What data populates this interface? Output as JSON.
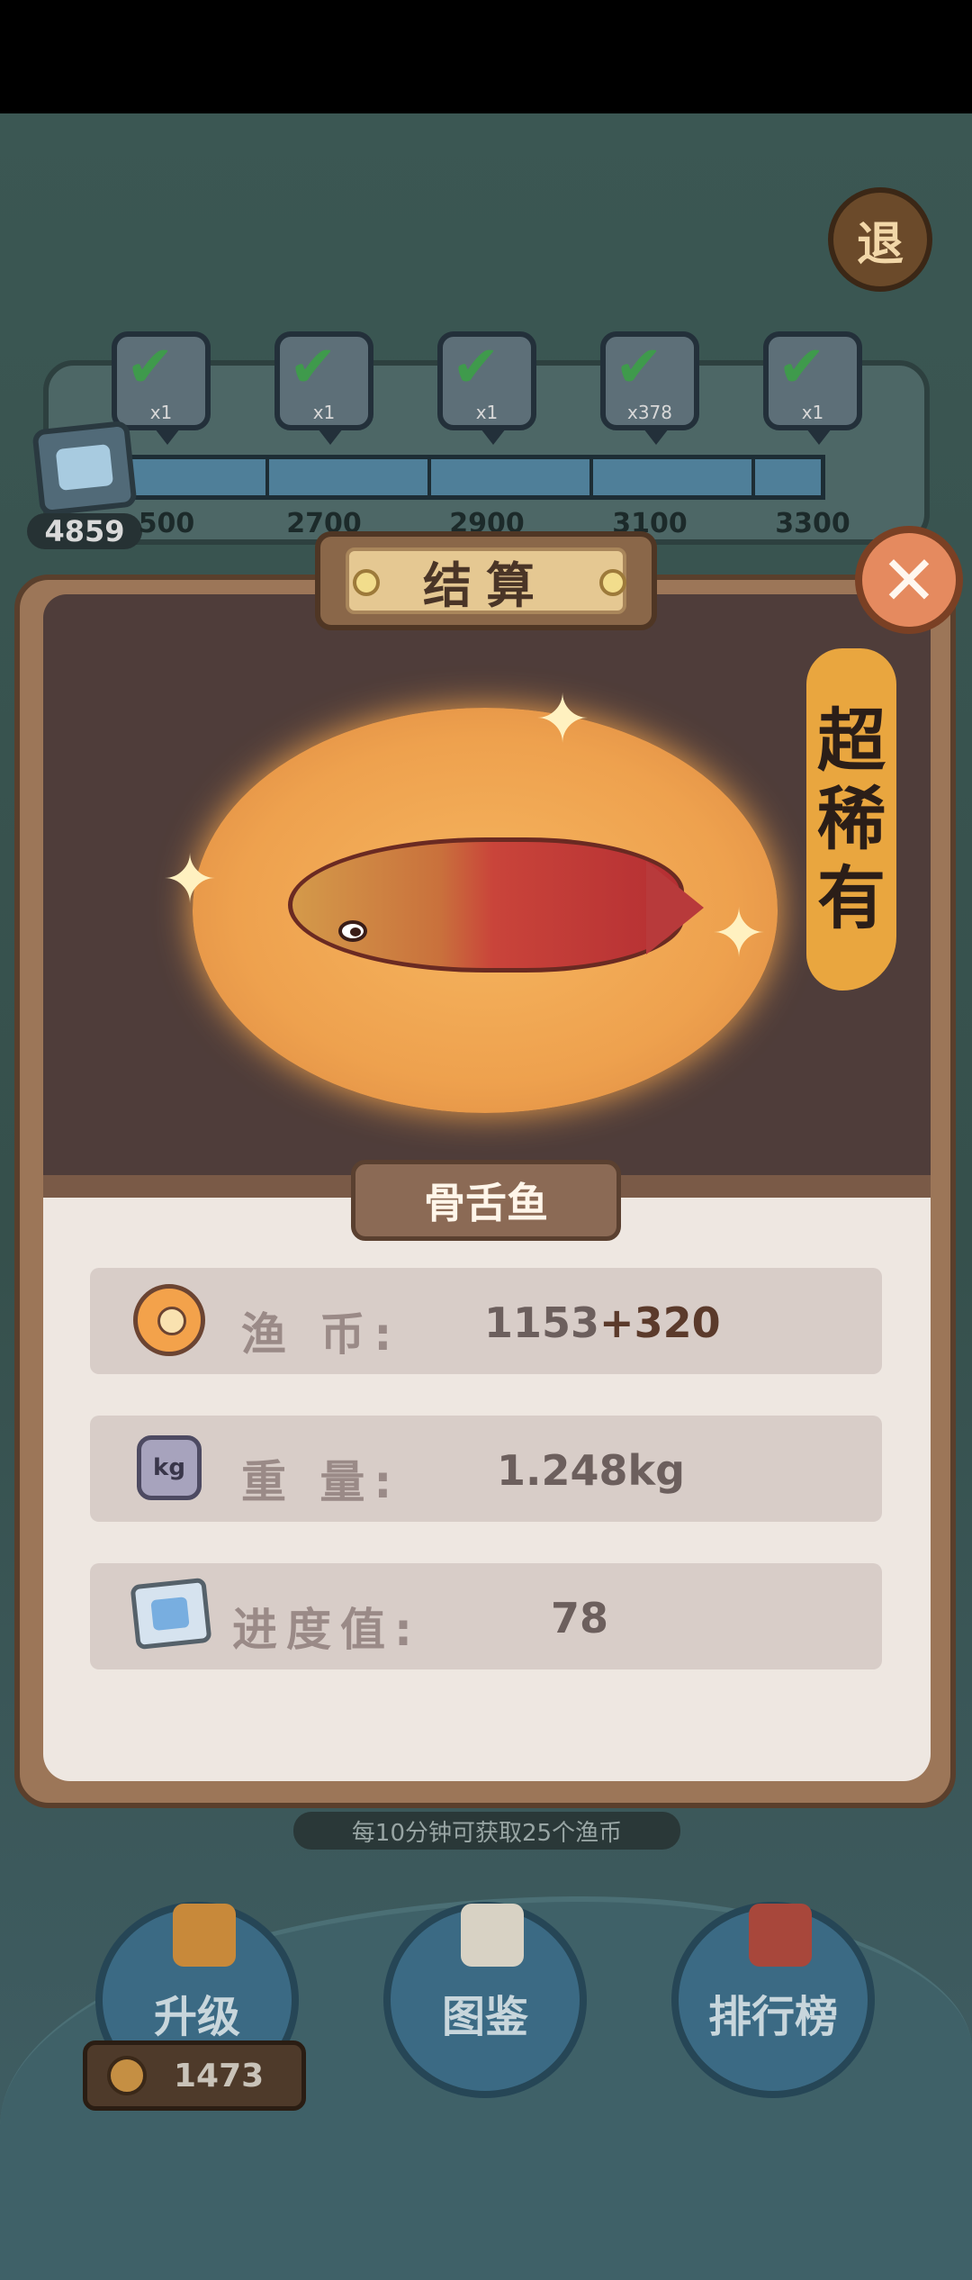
{
  "topbar": {
    "exit_label": "退"
  },
  "progress": {
    "total": "4859",
    "milestones": [
      "2500",
      "2700",
      "2900",
      "3100",
      "3300"
    ],
    "milestones_visible": [
      "500",
      "2700",
      "2900",
      "3100",
      "3300"
    ],
    "fill_fraction": 1.0
  },
  "rewards": [
    {
      "count": "x1"
    },
    {
      "count": "x1"
    },
    {
      "count": "x1"
    },
    {
      "count": "x378"
    },
    {
      "count": "x1"
    }
  ],
  "dialog": {
    "title": "结算",
    "rarity": [
      "超",
      "稀",
      "有"
    ],
    "fish_name": "骨舌鱼",
    "stats": [
      {
        "label": "渔 币:",
        "value": "1153",
        "extra": "+320",
        "icon": "coin-icon"
      },
      {
        "label": "重 量:",
        "value": "1.248kg",
        "icon": "weight-icon"
      },
      {
        "label": "进度值:",
        "value": "78",
        "icon": "ticket-icon"
      }
    ],
    "close_icon": "✕"
  },
  "tip": "每10分钟可获取25个渔币",
  "bottom_nav": {
    "upgrade": "升级",
    "collection": "图鉴",
    "leaderboard": "排行榜",
    "coins": "1473"
  }
}
